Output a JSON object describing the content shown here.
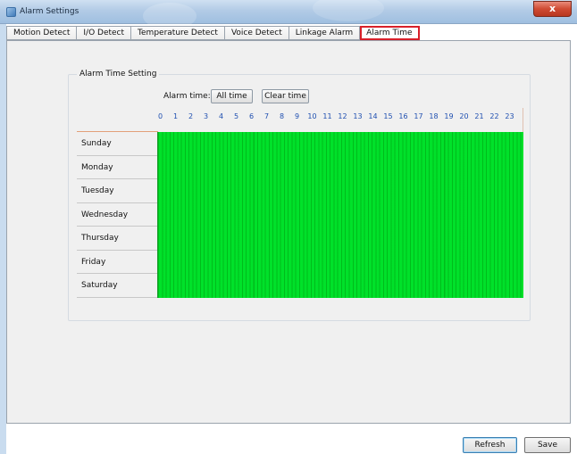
{
  "window": {
    "title": "Alarm Settings",
    "close_glyph": "x"
  },
  "tabs": [
    {
      "label": "Motion Detect",
      "active": false
    },
    {
      "label": "I/O Detect",
      "active": false
    },
    {
      "label": "Temperature Detect",
      "active": false
    },
    {
      "label": "Voice Detect",
      "active": false
    },
    {
      "label": "Linkage Alarm",
      "active": false
    },
    {
      "label": "Alarm Time",
      "active": true
    }
  ],
  "alarm_time": {
    "group_title": "Alarm Time Setting",
    "alarm_time_label": "Alarm time:",
    "all_time_button": "All time",
    "clear_time_button": "Clear time",
    "hours": [
      "0",
      "1",
      "2",
      "3",
      "4",
      "5",
      "6",
      "7",
      "8",
      "9",
      "10",
      "11",
      "12",
      "13",
      "14",
      "15",
      "16",
      "17",
      "18",
      "19",
      "20",
      "21",
      "22",
      "23"
    ],
    "days": [
      "Sunday",
      "Monday",
      "Tuesday",
      "Wednesday",
      "Thursday",
      "Friday",
      "Saturday"
    ],
    "schedule_color": "#00e12a",
    "schedule_state": "all slots selected"
  },
  "footer": {
    "refresh_button": "Refresh",
    "save_button": "Save"
  },
  "colors": {
    "hour_label": "#1f4fb0",
    "active_tab_outline": "#d8202a",
    "close_button": "#cf4b33"
  }
}
